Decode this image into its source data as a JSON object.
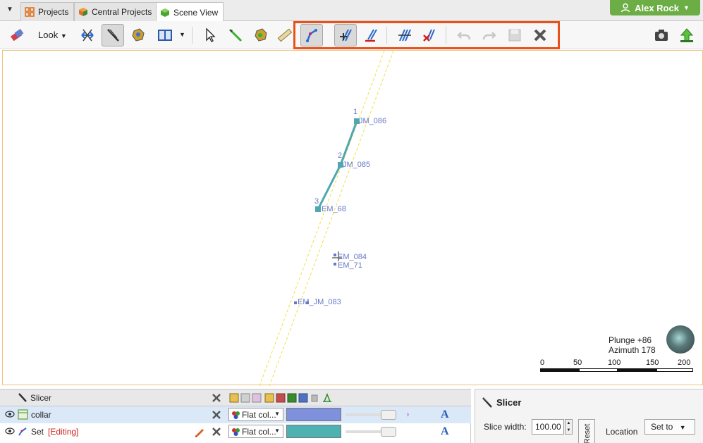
{
  "tabs": [
    {
      "label": "Projects",
      "active": false
    },
    {
      "label": "Central Projects",
      "active": false
    },
    {
      "label": "Scene View",
      "active": true
    }
  ],
  "user": {
    "name": "Alex Rock"
  },
  "toolbar": {
    "look_label": "Look",
    "highlight_color": "#e8521a"
  },
  "scene": {
    "points": [
      {
        "label": "JM_086",
        "order": "1"
      },
      {
        "label": "JM_085",
        "order": "2"
      },
      {
        "label": "EM_68",
        "order": "3"
      },
      {
        "label": "EM_084",
        "order": ""
      },
      {
        "label": "EM_71",
        "order": ""
      },
      {
        "label": "EM_JM_083",
        "order": ""
      }
    ],
    "plunge_text": "Plunge +86",
    "azimuth_text": "Azimuth 178",
    "scale_ticks": [
      "0",
      "50",
      "100",
      "150",
      "200"
    ]
  },
  "layers_panel": {
    "title": "Slicer",
    "rows": [
      {
        "name": "collar",
        "editing": "",
        "color_mode": "Flat col...",
        "swatch": "#7f90dc"
      },
      {
        "name": "Set",
        "editing": "[Editing]",
        "color_mode": "Flat col...",
        "swatch": "#4fb2b2"
      }
    ]
  },
  "properties_panel": {
    "title": "Slicer",
    "slice_width_label": "Slice width:",
    "slice_width_value": "100.00",
    "reset_label": "Reset",
    "location_label": "Location",
    "set_to_label": "Set to"
  },
  "colors": {
    "drillhole_line": "#4fa7b0",
    "slice_plane": "#f0e040",
    "label_text": "#6878c8",
    "user_button": "#6cae45"
  }
}
